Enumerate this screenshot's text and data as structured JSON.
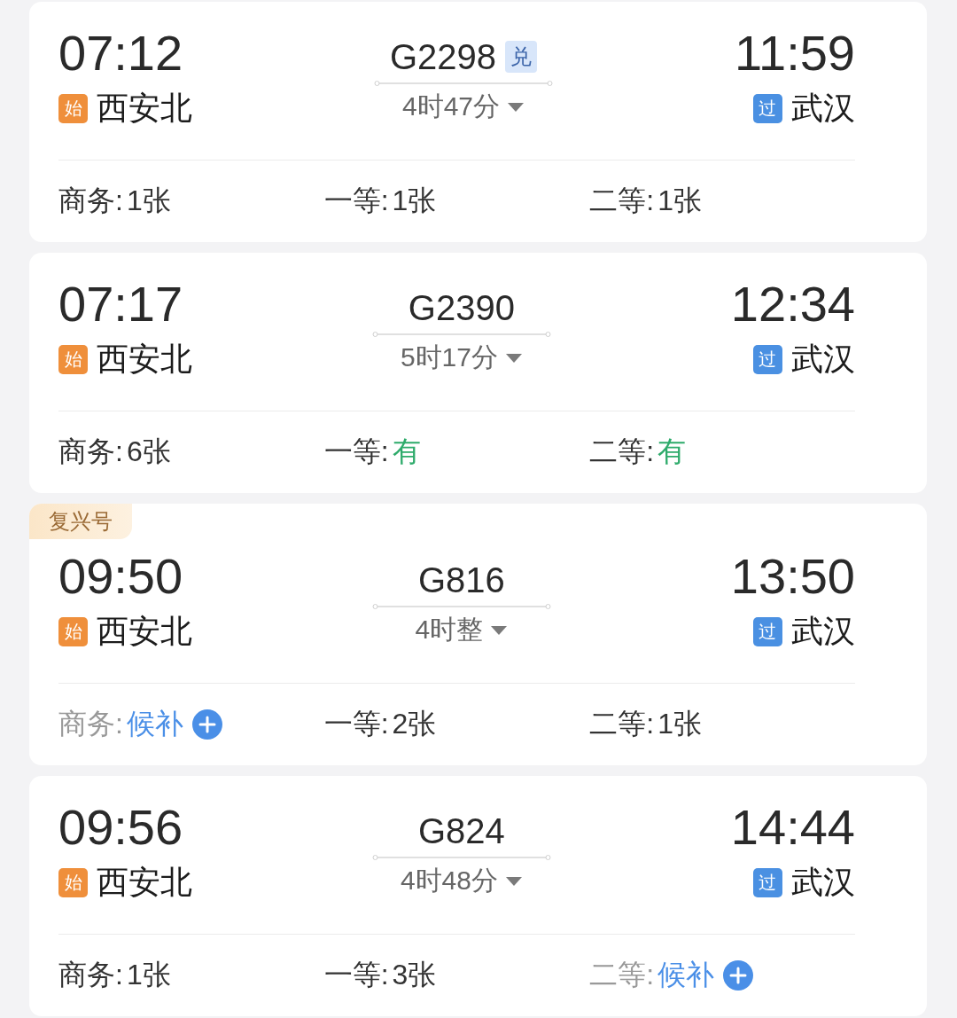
{
  "trains": [
    {
      "depart_time": "07:12",
      "depart_badge": "始",
      "depart_station": "西安北",
      "train_no": "G2298",
      "exchange_badge": "兑",
      "duration": "4时47分",
      "arrive_time": "11:59",
      "arrive_badge": "过",
      "arrive_station": "武汉",
      "seats": [
        {
          "label": "商务:",
          "value": "1张",
          "kind": "count"
        },
        {
          "label": "一等:",
          "value": "1张",
          "kind": "count"
        },
        {
          "label": "二等:",
          "value": "1张",
          "kind": "count"
        }
      ]
    },
    {
      "depart_time": "07:17",
      "depart_badge": "始",
      "depart_station": "西安北",
      "train_no": "G2390",
      "duration": "5时17分",
      "arrive_time": "12:34",
      "arrive_badge": "过",
      "arrive_station": "武汉",
      "seats": [
        {
          "label": "商务:",
          "value": "6张",
          "kind": "count"
        },
        {
          "label": "一等:",
          "value": "有",
          "kind": "available"
        },
        {
          "label": "二等:",
          "value": "有",
          "kind": "available"
        }
      ]
    },
    {
      "tag": "复兴号",
      "depart_time": "09:50",
      "depart_badge": "始",
      "depart_station": "西安北",
      "train_no": "G816",
      "duration": "4时整",
      "arrive_time": "13:50",
      "arrive_badge": "过",
      "arrive_station": "武汉",
      "seats": [
        {
          "label": "商务:",
          "value": "候补",
          "kind": "waitlist"
        },
        {
          "label": "一等:",
          "value": "2张",
          "kind": "count"
        },
        {
          "label": "二等:",
          "value": "1张",
          "kind": "count"
        }
      ]
    },
    {
      "depart_time": "09:56",
      "depart_badge": "始",
      "depart_station": "西安北",
      "train_no": "G824",
      "duration": "4时48分",
      "arrive_time": "14:44",
      "arrive_badge": "过",
      "arrive_station": "武汉",
      "seats": [
        {
          "label": "商务:",
          "value": "1张",
          "kind": "count"
        },
        {
          "label": "一等:",
          "value": "3张",
          "kind": "count"
        },
        {
          "label": "二等:",
          "value": "候补",
          "kind": "waitlist"
        }
      ]
    }
  ]
}
